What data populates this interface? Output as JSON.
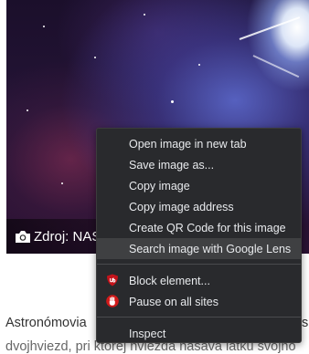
{
  "hero": {
    "caption_text": "Zdroj: NAS"
  },
  "article": {
    "line1": "Astronómovia",
    "line1_tail": "si",
    "line2": "dvojhviezd, pri ktorej hviezda nasáva látku svojho"
  },
  "context_menu": {
    "group1": [
      {
        "label": "Open image in new tab"
      },
      {
        "label": "Save image as..."
      },
      {
        "label": "Copy image"
      },
      {
        "label": "Copy image address"
      },
      {
        "label": "Create QR Code for this image"
      },
      {
        "label": "Search image with Google Lens",
        "highlighted": true
      }
    ],
    "group2": [
      {
        "label": "Block element...",
        "icon": "ublock-origin-icon"
      },
      {
        "label": "Pause on all sites",
        "icon": "hand-stop-icon"
      }
    ],
    "group3": [
      {
        "label": "Inspect"
      }
    ]
  },
  "colors": {
    "menu_bg": "#292a2d",
    "menu_text": "#e8eaed",
    "menu_highlight": "#3f4042",
    "ext_icon_red": "#c4131b"
  }
}
